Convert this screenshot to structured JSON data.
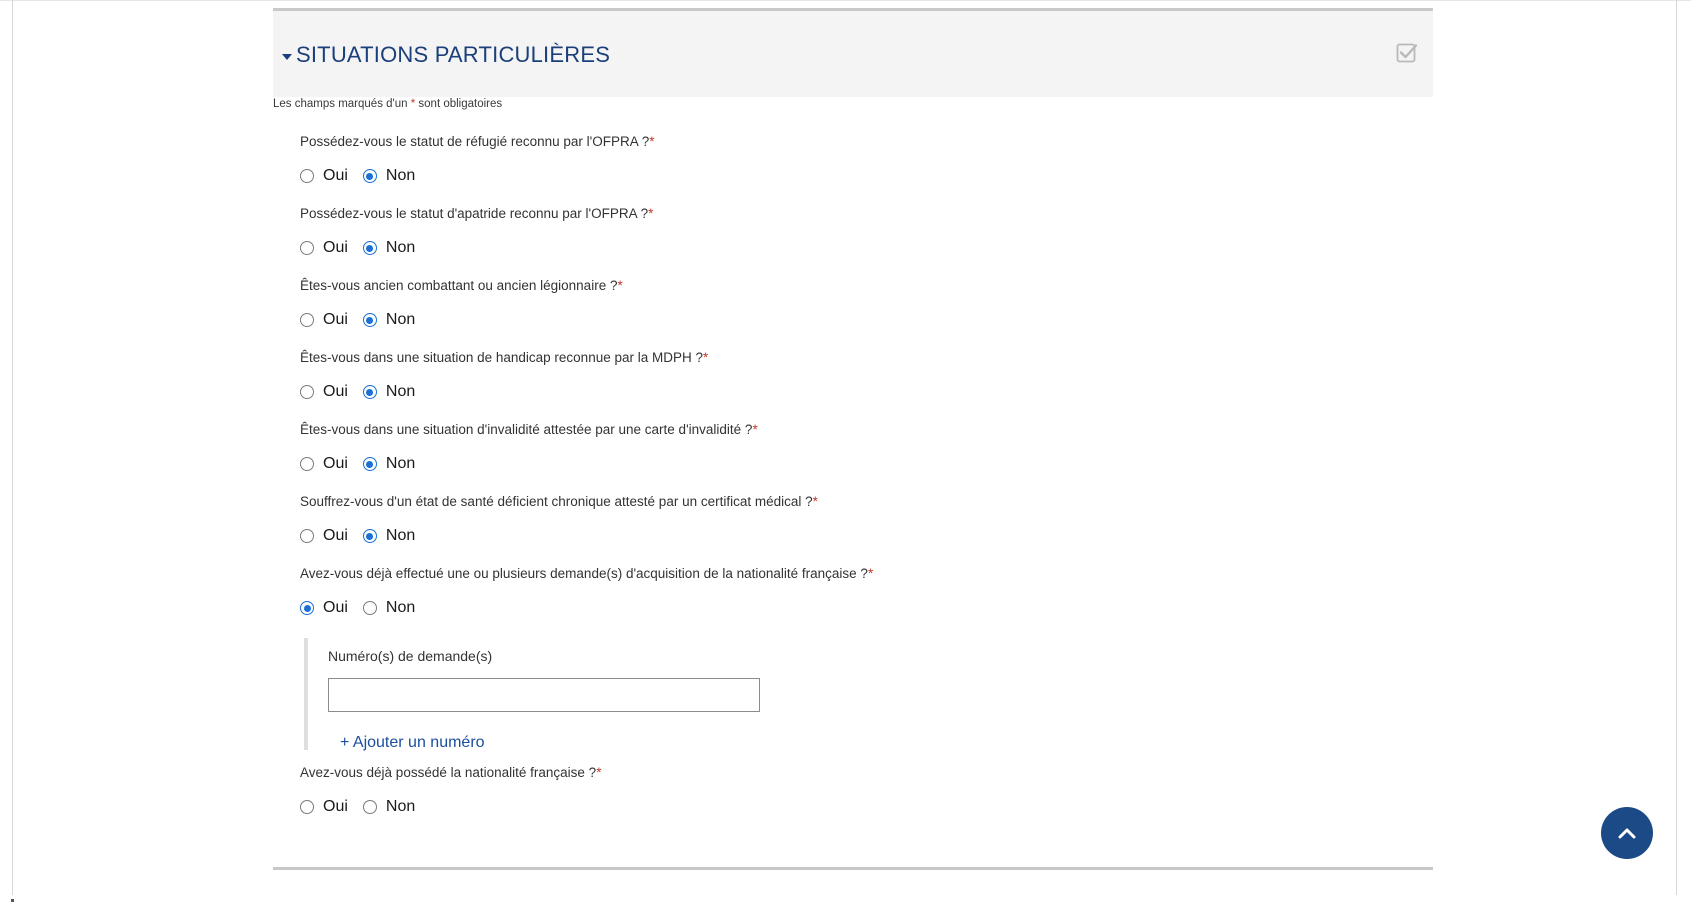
{
  "section": {
    "title": "SITUATIONS PARTICULIÈRES",
    "required_note_prefix": "Les champs marqués d'un ",
    "required_note_star": "*",
    "required_note_suffix": " sont obligatoires"
  },
  "questions": [
    {
      "text": "Possédez-vous le statut de réfugié reconnu par l'OFPRA ?",
      "star": "*",
      "yes": "Oui",
      "no": "Non",
      "selected": "Non"
    },
    {
      "text": "Possédez-vous le statut d'apatride reconnu par l'OFPRA ?",
      "star": "*",
      "yes": "Oui",
      "no": "Non",
      "selected": "Non"
    },
    {
      "text": "Êtes-vous ancien combattant ou ancien légionnaire ?",
      "star": "*",
      "yes": "Oui",
      "no": "Non",
      "selected": "Non"
    },
    {
      "text": "Êtes-vous dans une situation de handicap reconnue par la MDPH ?",
      "star": "*",
      "yes": "Oui",
      "no": "Non",
      "selected": "Non"
    },
    {
      "text": "Êtes-vous dans une situation d'invalidité attestée par une carte d'invalidité ?",
      "star": "*",
      "yes": "Oui",
      "no": "Non",
      "selected": "Non"
    },
    {
      "text": "Souffrez-vous d'un état de santé déficient chronique attesté par un certificat médical ?",
      "star": "*",
      "yes": "Oui",
      "no": "Non",
      "selected": "Non"
    },
    {
      "text": "Avez-vous déjà effectué une ou plusieurs demande(s) d'acquisition de la nationalité française ?",
      "star": "*",
      "yes": "Oui",
      "no": "Non",
      "selected": "Oui"
    },
    {
      "text": "Avez-vous déjà possédé la nationalité française ?",
      "star": "*",
      "yes": "Oui",
      "no": "Non",
      "selected": ""
    }
  ],
  "request_numbers": {
    "label": "Numéro(s) de demande(s)",
    "value": "",
    "add_link": "+ Ajouter un numéro"
  },
  "colors": {
    "title": "#1b3f7a",
    "radio_checked": "#1c6fd6",
    "required_star": "#c0392b",
    "scroll_button": "#1b4a86"
  },
  "icons": {
    "section_toggle": "caret-down-icon",
    "section_status": "checkbox-checked-icon",
    "scroll_top": "chevron-up-icon"
  }
}
